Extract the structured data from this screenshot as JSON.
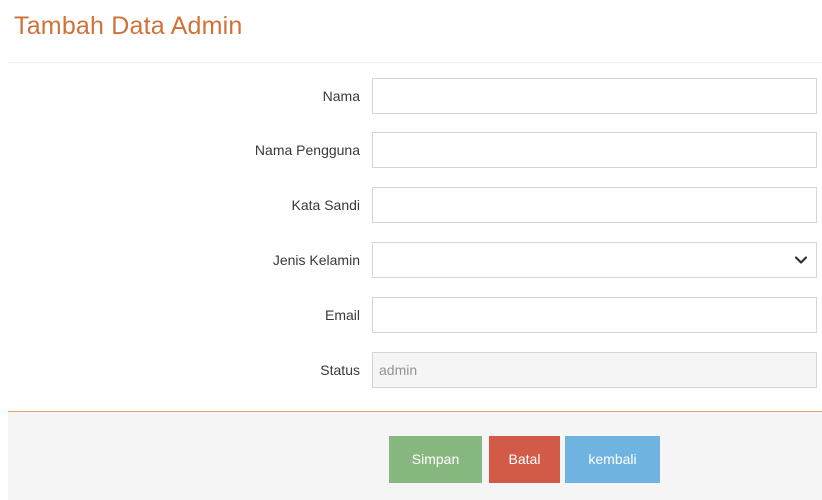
{
  "page": {
    "title": "Tambah Data Admin"
  },
  "form": {
    "fields": [
      {
        "label": "Nama",
        "value": ""
      },
      {
        "label": "Nama Pengguna",
        "value": ""
      },
      {
        "label": "Kata Sandi",
        "value": ""
      },
      {
        "label": "Jenis Kelamin",
        "value": ""
      },
      {
        "label": "Email",
        "value": ""
      },
      {
        "label": "Status",
        "value": "admin"
      }
    ]
  },
  "actions": {
    "save_label": "Simpan",
    "cancel_label": "Batal",
    "back_label": "kembali"
  },
  "colors": {
    "title": "#d0713a",
    "save": "#87b87f",
    "cancel": "#d15b47",
    "back": "#6fb3e0",
    "actions_border": "#e5a173"
  },
  "icons": {
    "select_arrow": "chevron-down-icon"
  }
}
